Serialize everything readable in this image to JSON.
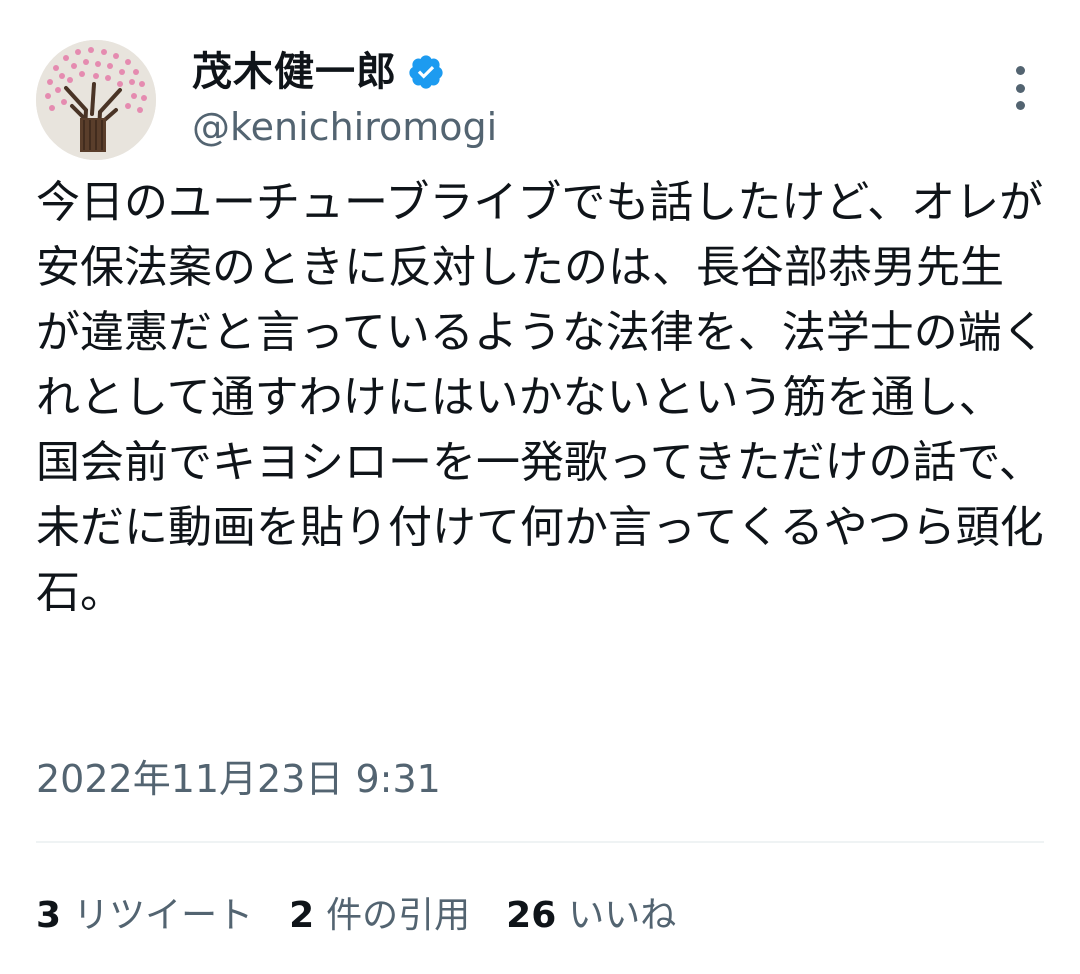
{
  "user": {
    "display_name": "茂木健一郎",
    "handle": "@kenichiromogi",
    "verified_badge": "verified-badge-icon",
    "avatar_icon": "avatar-tree-drawing"
  },
  "tweet": {
    "text": "今日のユーチューブライブでも話したけど、オレが安保法案のときに反対したのは、長谷部恭男先生が違憲だと言っているような法律を、法学士の端くれとして通すわけにはいかないという筋を通し、国会前でキヨシローを一発歌ってきただけの話で、未だに動画を貼り付けて何か言ってくるやつら頭化石。",
    "timestamp": "2022年11月23日 9:31"
  },
  "stats": {
    "retweets": {
      "count": "3",
      "label": "リツイート"
    },
    "quotes": {
      "count": "2",
      "label": "件の引用"
    },
    "likes": {
      "count": "26",
      "label": "いいね"
    }
  },
  "colors": {
    "text_primary": "#0f1419",
    "text_secondary": "#536471",
    "verified_blue": "#1d9bf0",
    "divider": "#eff3f4"
  }
}
